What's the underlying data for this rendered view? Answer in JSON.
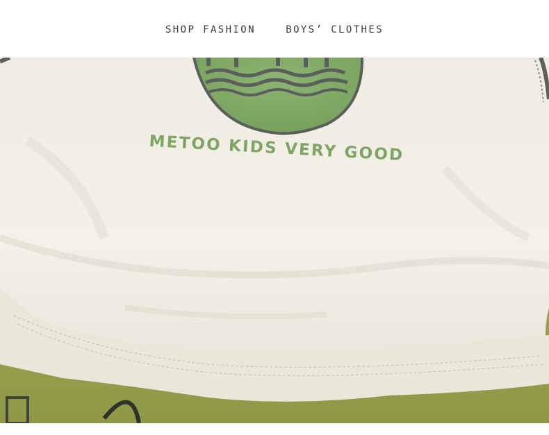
{
  "header": {
    "left_text": "SHOP FASHION",
    "right_text": "BOYS’ CLOTHES"
  },
  "photo": {
    "print_text": "METOO KIDS VERY GOOD",
    "colors": {
      "shirt": "#f1efe6",
      "shirt_shadow": "#dcd9cc",
      "print_green": "#7fa565",
      "print_gray": "#5b5f5c",
      "shorts": "#a3ab55",
      "sleeve_edge": "#6a6d5c"
    }
  }
}
